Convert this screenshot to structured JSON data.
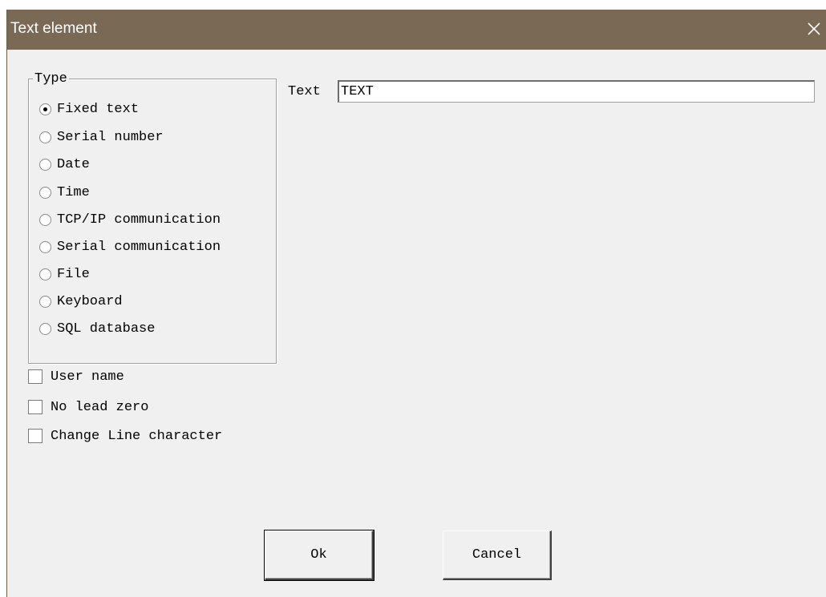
{
  "window": {
    "title": "Text element",
    "close_icon": "close-icon",
    "titlebar_color": "#7a6a55"
  },
  "type_group": {
    "label": "Type",
    "selected": "Fixed text",
    "options": [
      "Fixed text",
      "Serial number",
      "Date",
      "Time",
      "TCP/IP communication",
      "Serial communication",
      "File",
      "Keyboard",
      "SQL database"
    ]
  },
  "options": {
    "user_name": {
      "label": "User name",
      "checked": false
    },
    "no_lead_zero": {
      "label": "No lead zero",
      "checked": false
    },
    "change_line": {
      "label": "Change Line character",
      "checked": false
    }
  },
  "text_field": {
    "label": "Text",
    "value": "TEXT"
  },
  "buttons": {
    "ok": "Ok",
    "cancel": "Cancel"
  }
}
